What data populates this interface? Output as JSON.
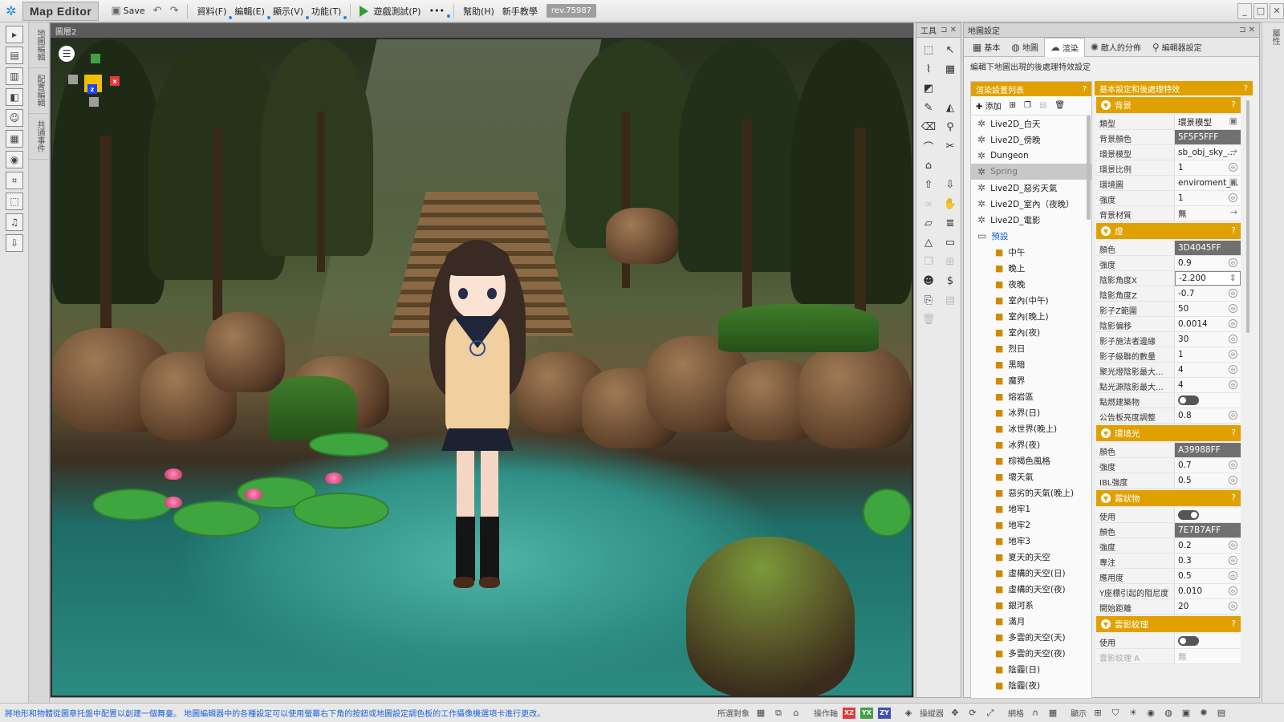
{
  "app": {
    "title": "Map Editor"
  },
  "menubar": {
    "save": "Save",
    "menus": [
      "資料(F)",
      "編輯(E)",
      "顯示(V)",
      "功能(T)"
    ],
    "playtest": "遊戲測試(P)",
    "more": "•••",
    "help": "幫助(H)",
    "tutorial": "新手教學",
    "revision": "rev.75987"
  },
  "left_tabs": [
    "地圖編輯",
    "配置編輯",
    "共通事件"
  ],
  "viewport": {
    "tab": "圖層2",
    "gizmo": {
      "x_label": "x",
      "z_label": "z",
      "x_color": "#e53935",
      "y_color": "#43a047",
      "z_color": "#1e40ff"
    }
  },
  "tools_panel": {
    "title": "工具"
  },
  "map_settings": {
    "title": "地圖設定",
    "tabs": [
      {
        "label": "基本",
        "icon": "grid-icon"
      },
      {
        "label": "地圖",
        "icon": "globe-icon"
      },
      {
        "label": "渲染",
        "icon": "render-icon"
      },
      {
        "label": "敵人的分佈",
        "icon": "enemy-icon"
      },
      {
        "label": "編輯器設定",
        "icon": "pin-icon"
      }
    ],
    "description": "編輯下地圖出現的後處理特效設定",
    "render_list": {
      "header": "渲染設置列表",
      "add_label": "添加",
      "items": [
        {
          "label": "Live2D_白天",
          "type": "gear"
        },
        {
          "label": "Live2D_傍晚",
          "type": "gear"
        },
        {
          "label": "Dungeon",
          "type": "gear"
        },
        {
          "label": "Spring",
          "type": "gear",
          "selected": true
        },
        {
          "label": "Live2D_惡劣天氣",
          "type": "gear"
        },
        {
          "label": "Live2D_室內（夜晚）",
          "type": "gear"
        },
        {
          "label": "Live2D_電影",
          "type": "gear"
        }
      ],
      "folder": "預設",
      "presets": [
        "中午",
        "晚上",
        "夜晚",
        "室內(中午)",
        "室內(晚上)",
        "室內(夜)",
        "烈日",
        "黑暗",
        "魔界",
        "熔岩區",
        "冰界(日)",
        "冰世界(晚上)",
        "冰界(夜)",
        "棕褐色風格",
        "壞天氣",
        "惡劣的天氣(晚上)",
        "地牢1",
        "地牢2",
        "地牢3",
        "夏天的天空",
        "虛構的天空(日)",
        "虛構的天空(夜)",
        "銀河系",
        "滿月",
        "多雲的天空(天)",
        "多雲的天空(夜)",
        "陰霾(日)",
        "陰霾(夜)"
      ]
    },
    "props": {
      "header": "基本設定和後處理特效",
      "sections": [
        {
          "title": "背景",
          "rows": [
            {
              "key": "類型",
              "value": "環景模型",
              "action": "check"
            },
            {
              "key": "背景顏色",
              "value": "5F5F5FFF",
              "color": true,
              "action": "arrow"
            },
            {
              "key": "環景模型",
              "value": "sb_obj_sky_...",
              "action": "arrow"
            },
            {
              "key": "環景比例",
              "value": "1",
              "action": "circle"
            },
            {
              "key": "環境圖",
              "value": "enviroment_...",
              "action": "check"
            },
            {
              "key": "強度",
              "value": "1",
              "action": "circle"
            },
            {
              "key": "背景材質",
              "value": "無",
              "action": "arrow"
            }
          ]
        },
        {
          "title": "燈",
          "rows": [
            {
              "key": "顏色",
              "value": "3D4045FF",
              "color": true,
              "action": "arrow"
            },
            {
              "key": "強度",
              "value": "0.9",
              "action": "circle"
            },
            {
              "key": "陰影角度X",
              "value": "-2.200",
              "editing": true,
              "action": "spin"
            },
            {
              "key": "陰影角度Z",
              "value": "-0.7",
              "action": "circle"
            },
            {
              "key": "影子Z範圍",
              "value": "50",
              "action": "circle"
            },
            {
              "key": "陰影偏移",
              "value": "0.0014",
              "action": "circle"
            },
            {
              "key": "影子施法者邊緣",
              "value": "30",
              "action": "circle"
            },
            {
              "key": "影子級聯的數量",
              "value": "1",
              "action": "circle"
            },
            {
              "key": "聚光燈陰影最大...",
              "value": "4",
              "action": "circle"
            },
            {
              "key": "點光源陰影最大...",
              "value": "4",
              "action": "circle"
            },
            {
              "key": "點燃建築物",
              "toggle": false
            },
            {
              "key": "公告板亮度調整",
              "value": "0.8",
              "action": "circle"
            }
          ]
        },
        {
          "title": "環境光",
          "rows": [
            {
              "key": "顏色",
              "value": "A39988FF",
              "color": true
            },
            {
              "key": "強度",
              "value": "0.7",
              "action": "circle"
            },
            {
              "key": "IBL強度",
              "value": "0.5",
              "action": "circle"
            }
          ]
        },
        {
          "title": "霧狀物",
          "rows": [
            {
              "key": "使用",
              "toggle": true
            },
            {
              "key": "顏色",
              "value": "7E7B7AFF",
              "color": true,
              "action": "arrow"
            },
            {
              "key": "強度",
              "value": "0.2",
              "action": "circle"
            },
            {
              "key": "專注",
              "value": "0.3",
              "action": "circle"
            },
            {
              "key": "應用度",
              "value": "0.5",
              "action": "circle"
            },
            {
              "key": "Y座標引起的阻尼度",
              "value": "0.010",
              "action": "circle"
            },
            {
              "key": "開始距離",
              "value": "20",
              "action": "circle"
            }
          ]
        },
        {
          "title": "雲影紋理",
          "rows": [
            {
              "key": "使用",
              "toggle": false
            },
            {
              "key": "雲影紋理 A",
              "value": "無",
              "disabled": true
            }
          ]
        }
      ]
    }
  },
  "right_strip": [
    "屬性"
  ],
  "statusbar": {
    "message": "將地形和物體從圖章托盤中配置以創建一個舞臺。 地圖編輯器中的各種設定可以使用螢幕右下角的按鈕或地圖設定調色板的工作攝像機選項卡進行更改。",
    "select_target": "所選對象",
    "operation": "操作軸",
    "axes": [
      "XZ",
      "YX",
      "ZY"
    ],
    "gizmo": "操縱器",
    "grid": "網格",
    "display": "顯示"
  },
  "colors": {
    "accent": "#e0a100",
    "link": "#1e63d8",
    "playtest": "#2e9b35"
  }
}
